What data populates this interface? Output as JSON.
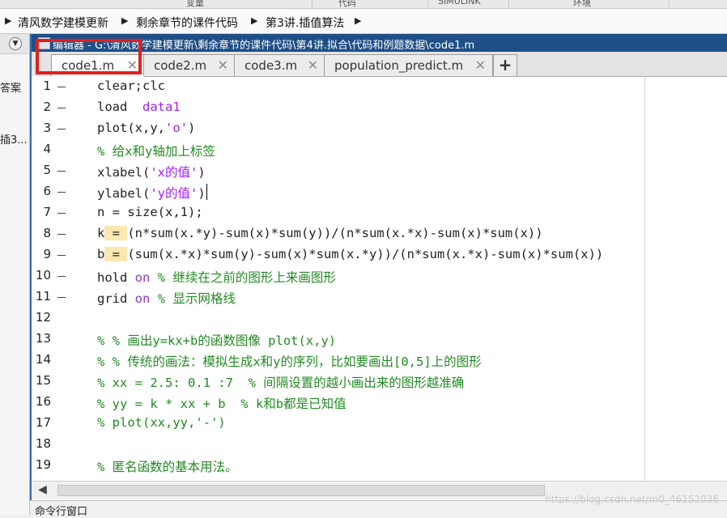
{
  "top_ribbon": {
    "labels": [
      "变量",
      "代码",
      "SIMULINK",
      "环境"
    ]
  },
  "address_bar": {
    "segments": [
      "清风数学建模更新",
      "剩余章节的课件代码",
      "第3讲.插值算法"
    ]
  },
  "left_panel": {
    "line1": "答案",
    "line2": "插3..."
  },
  "editor": {
    "title": "编辑器 - G:\\清风数学建模更新\\剩余章节的课件代码\\第4讲.拟合\\代码和例题数据\\code1.m",
    "tabs": [
      {
        "label": "code1.m",
        "active": true
      },
      {
        "label": "code2.m",
        "active": false
      },
      {
        "label": "code3.m",
        "active": false
      },
      {
        "label": "population_predict.m",
        "active": false
      }
    ],
    "close_glyph": "✕",
    "add_tab_glyph": "+",
    "lines": [
      {
        "n": "1",
        "dash": true,
        "parts": [
          {
            "t": "clear;clc",
            "c": ""
          }
        ]
      },
      {
        "n": "2",
        "dash": true,
        "parts": [
          {
            "t": "load  ",
            "c": ""
          },
          {
            "t": "data1",
            "c": "str"
          }
        ]
      },
      {
        "n": "3",
        "dash": true,
        "parts": [
          {
            "t": "plot(x,y,",
            "c": ""
          },
          {
            "t": "'o'",
            "c": "str"
          },
          {
            "t": ")",
            "c": ""
          }
        ]
      },
      {
        "n": "4",
        "dash": false,
        "parts": [
          {
            "t": "% 给x和y轴加上标签",
            "c": "cmt"
          }
        ]
      },
      {
        "n": "5",
        "dash": true,
        "parts": [
          {
            "t": "xlabel(",
            "c": ""
          },
          {
            "t": "'x的值'",
            "c": "str"
          },
          {
            "t": ")",
            "c": ""
          }
        ]
      },
      {
        "n": "6",
        "dash": true,
        "parts": [
          {
            "t": "ylabel(",
            "c": ""
          },
          {
            "t": "'y的值'",
            "c": "str"
          },
          {
            "t": ")",
            "c": ""
          }
        ]
      },
      {
        "n": "7",
        "dash": true,
        "parts": [
          {
            "t": "n = size(x,1);",
            "c": ""
          }
        ]
      },
      {
        "n": "8",
        "dash": true,
        "parts": [
          {
            "t": "k",
            "c": ""
          },
          {
            "t": " = ",
            "c": "hlk"
          },
          {
            "t": "(n*sum(x.*y)-sum(x)*sum(y))/(n*sum(x.*x)-sum(x)*sum(x))",
            "c": ""
          }
        ]
      },
      {
        "n": "9",
        "dash": true,
        "parts": [
          {
            "t": "b",
            "c": ""
          },
          {
            "t": " = ",
            "c": "hlk"
          },
          {
            "t": "(sum(x.*x)*sum(y)-sum(x)*sum(x.*y))/(n*sum(x.*x)-sum(x)*sum(x))",
            "c": ""
          }
        ]
      },
      {
        "n": "10",
        "dash": true,
        "parts": [
          {
            "t": "hold ",
            "c": ""
          },
          {
            "t": "on",
            "c": "kw"
          },
          {
            "t": " % 继续在之前的图形上来画图形",
            "c": "cmt"
          }
        ]
      },
      {
        "n": "11",
        "dash": true,
        "parts": [
          {
            "t": "grid ",
            "c": ""
          },
          {
            "t": "on",
            "c": "kw"
          },
          {
            "t": " % 显示网格线",
            "c": "cmt"
          }
        ]
      },
      {
        "n": "12",
        "dash": false,
        "parts": []
      },
      {
        "n": "13",
        "dash": false,
        "parts": [
          {
            "t": "% % 画出y=kx+b的函数图像 plot(x,y)",
            "c": "cmt"
          }
        ]
      },
      {
        "n": "14",
        "dash": false,
        "parts": [
          {
            "t": "% % 传统的画法：模拟生成x和y的序列，比如要画出[0,5]上的图形",
            "c": "cmt"
          }
        ]
      },
      {
        "n": "15",
        "dash": false,
        "parts": [
          {
            "t": "% xx = 2.5: 0.1 :7  % 间隔设置的越小画出来的图形越准确",
            "c": "cmt"
          }
        ]
      },
      {
        "n": "16",
        "dash": false,
        "parts": [
          {
            "t": "% yy = k * xx + b  % k和b都是已知值",
            "c": "cmt"
          }
        ]
      },
      {
        "n": "17",
        "dash": false,
        "parts": [
          {
            "t": "% plot(xx,yy,'-')",
            "c": "cmt"
          }
        ]
      },
      {
        "n": "18",
        "dash": false,
        "parts": []
      },
      {
        "n": "19",
        "dash": false,
        "parts": [
          {
            "t": "% 匿名函数的基本用法。",
            "c": "cmt"
          }
        ]
      }
    ]
  },
  "command_window": {
    "label": "命令行窗口"
  },
  "watermark": "https://blog.csdn.net/m0_46152036"
}
